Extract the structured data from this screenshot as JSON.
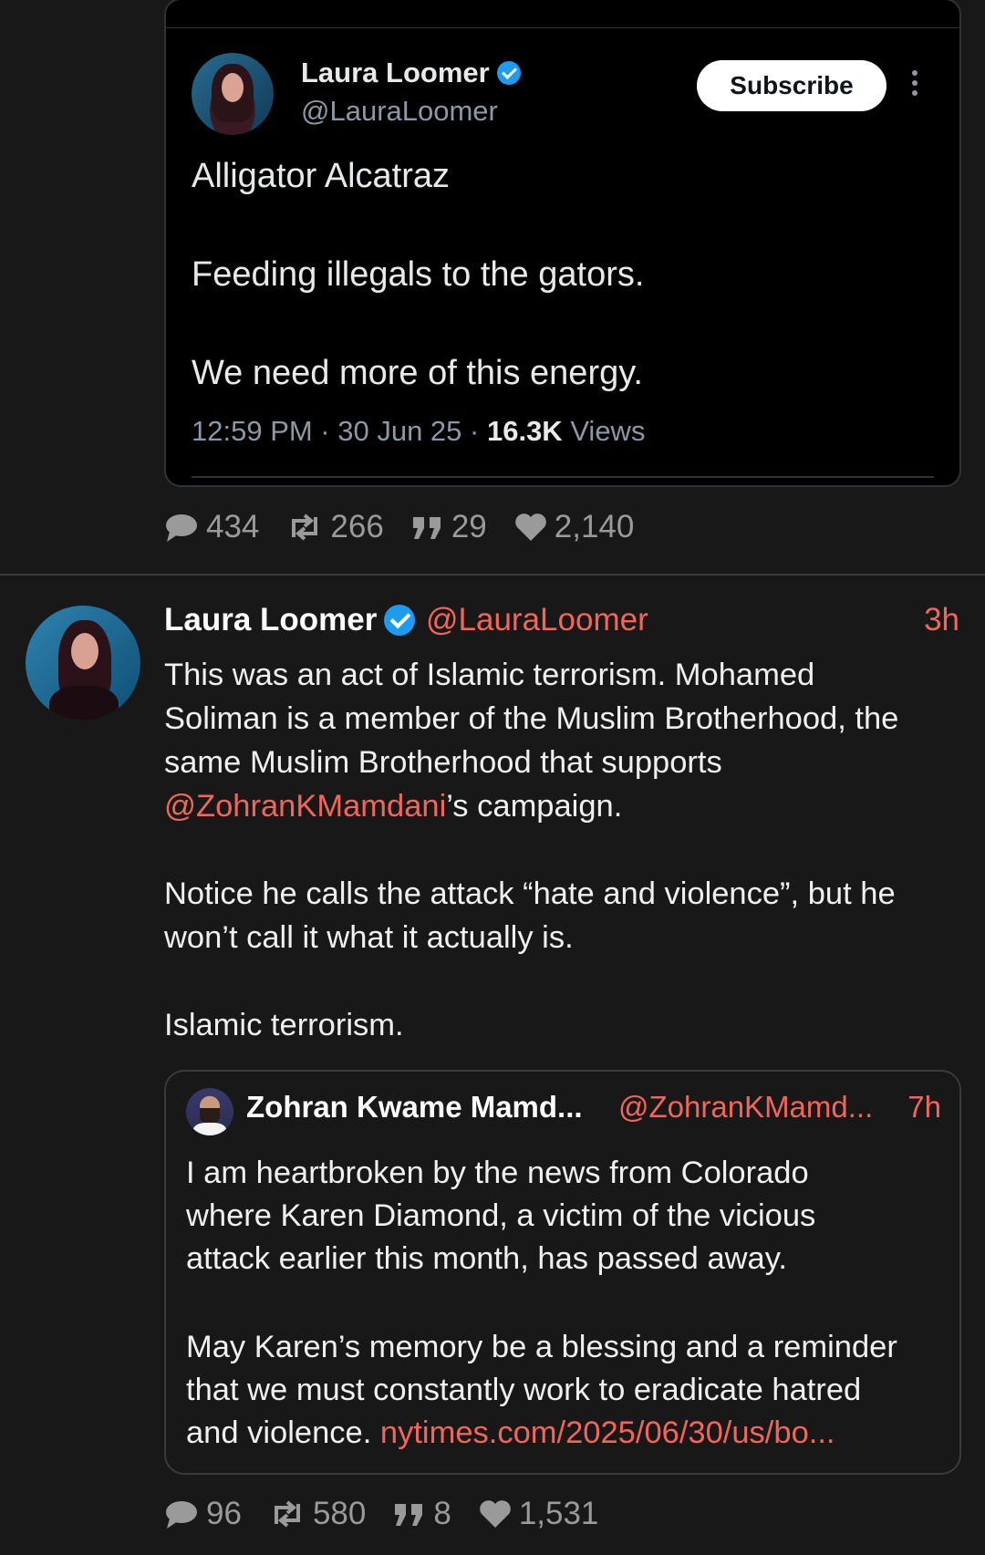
{
  "embedded_tweet": {
    "author_name": "Laura Loomer",
    "author_handle": "@LauraLoomer",
    "subscribe_label": "Subscribe",
    "lines": [
      "Alligator Alcatraz",
      "Feeding illegals to the gators.",
      "We need more of this energy."
    ],
    "time": "12:59 PM · 30 Jun 25 · ",
    "views_count": "16.3K",
    "views_label": " Views"
  },
  "post1_stats": {
    "replies": "434",
    "reposts": "266",
    "quotes": "29",
    "likes": "2,140"
  },
  "post2": {
    "author_name": "Laura Loomer",
    "author_handle": "@LauraLoomer",
    "time": "3h",
    "para1_lines": [
      "This was an act of Islamic terrorism. Mohamed",
      "Soliman is a member of the Muslim Brotherhood, the",
      "same Muslim Brotherhood that supports"
    ],
    "mention": "@ZohranKMamdani",
    "mention_suffix": "’s campaign.",
    "para2_lines": [
      "Notice he calls the attack “hate and violence”, but he",
      "won’t call it what it actually is."
    ],
    "para3": "Islamic terrorism.",
    "quote": {
      "author_name": "Zohran Kwame Mamd...",
      "author_handle": "@ZohranKMamd...",
      "time": "7h",
      "para1_lines": [
        "I am heartbroken by the news from Colorado",
        "where Karen Diamond, a victim of the vicious",
        "attack earlier this month, has passed away."
      ],
      "para2_lines": [
        "May Karen’s memory be a blessing and a reminder",
        "that we must constantly work to eradicate hatred"
      ],
      "last_line_text": "and violence. ",
      "link": "nytimes.com/2025/06/30/us/bo..."
    },
    "stats": {
      "replies": "96",
      "reposts": "580",
      "quotes": "8",
      "likes": "1,531"
    }
  },
  "colors": {
    "background": "#181818",
    "accent_link": "#f2665a",
    "verified": "#1d9bf0"
  }
}
